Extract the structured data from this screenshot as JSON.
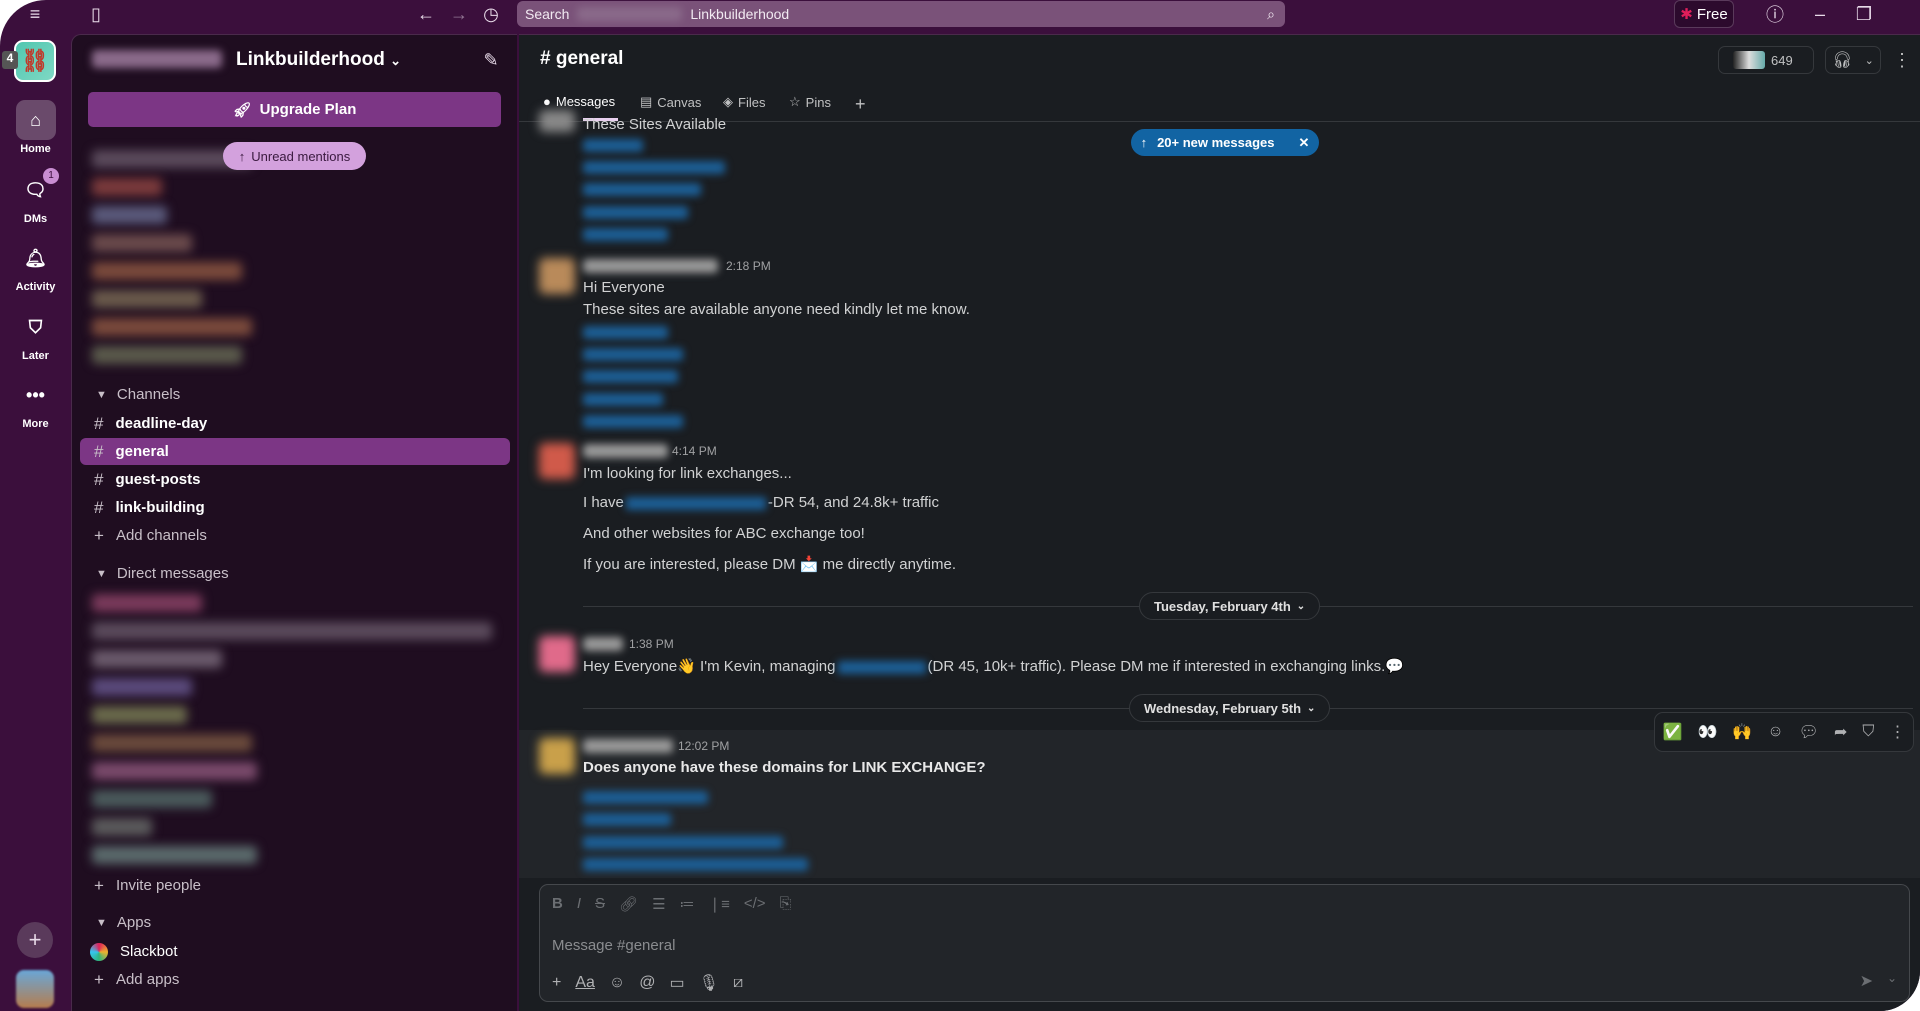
{
  "topbar": {
    "search_prefix": "Search",
    "search_workspace": "Linkbuilderhood",
    "plan": "Free"
  },
  "rail": {
    "workspace_badge": "4",
    "items": [
      {
        "label": "Home",
        "icon": "home-icon"
      },
      {
        "label": "DMs",
        "icon": "dms-icon",
        "badge": "1"
      },
      {
        "label": "Activity",
        "icon": "bell-icon"
      },
      {
        "label": "Later",
        "icon": "bookmark-icon"
      },
      {
        "label": "More",
        "icon": "more-icon"
      }
    ]
  },
  "sidebar": {
    "workspace_name": "Linkbuilderhood",
    "upgrade_label": "Upgrade Plan",
    "unread_mentions": "Unread mentions",
    "channels_header": "Channels",
    "channels": [
      "deadline-day",
      "general",
      "guest-posts",
      "link-building"
    ],
    "active_channel": "general",
    "add_channels": "Add channels",
    "dm_header": "Direct messages",
    "invite": "Invite people",
    "apps_header": "Apps",
    "apps": [
      "Slackbot"
    ],
    "add_apps": "Add apps"
  },
  "channel": {
    "title": "# general",
    "member_count": "649",
    "tabs": [
      {
        "label": "Messages",
        "icon": "message-icon"
      },
      {
        "label": "Canvas",
        "icon": "canvas-icon"
      },
      {
        "label": "Files",
        "icon": "files-icon"
      },
      {
        "label": "Pins",
        "icon": "pin-icon"
      }
    ]
  },
  "new_messages": "20+ new messages",
  "messages": [
    {
      "time": "",
      "lines": [
        "These Sites Available"
      ]
    },
    {
      "time": "2:18 PM",
      "lines": [
        "Hi Everyone",
        "These sites are available anyone need kindly let me know."
      ]
    },
    {
      "time": "4:14 PM",
      "lines": [
        "I'm looking for link exchanges...",
        "I have",
        "-DR 54, and 24.8k+ traffic",
        "And other websites for ABC exchange too!",
        "If you are interested, please DM 📩 me directly anytime."
      ]
    },
    {
      "time": "1:38 PM",
      "lines": [
        "Hey Everyone👋 I'm Kevin, managing",
        "(DR 45, 10k+ traffic). Please DM me if interested in exchanging links.💬"
      ]
    },
    {
      "time": "12:02 PM",
      "lines": [
        "Does anyone have these domains for LINK EXCHANGE?"
      ]
    }
  ],
  "dates": [
    "Tuesday, February 4th",
    "Wednesday, February 5th"
  ],
  "hover_actions": [
    "✅",
    "👀",
    "🙌"
  ],
  "composer": {
    "placeholder": "Message #general"
  },
  "colors": {
    "aubergine": "#3b0f3c",
    "accent": "#1264a3",
    "upgrade": "#7c3685"
  }
}
